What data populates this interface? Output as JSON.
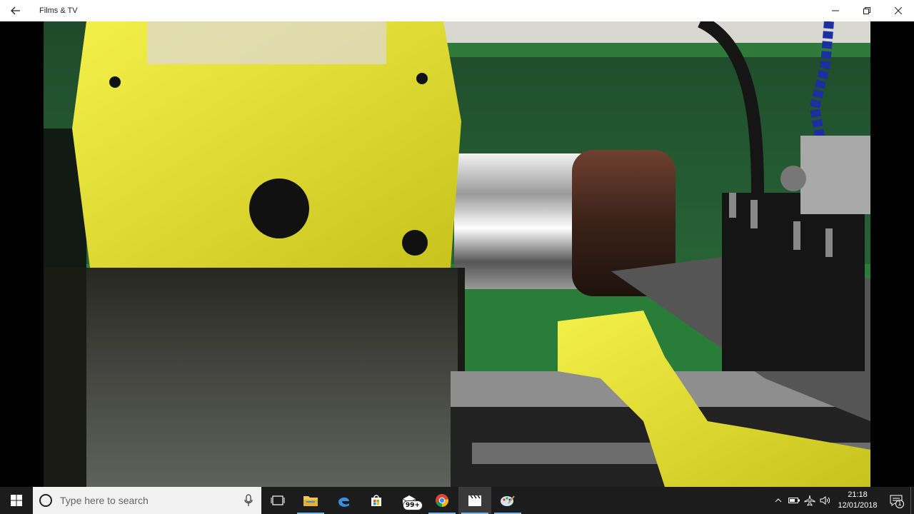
{
  "window": {
    "title": "Films & TV",
    "icons": {
      "back": "back-arrow-icon",
      "minimize": "minimize-icon",
      "restore": "restore-icon",
      "close": "close-icon"
    }
  },
  "video": {
    "description_icon": "video-frame"
  },
  "taskbar": {
    "search_placeholder": "Type here to search",
    "apps": [
      {
        "name": "task-view",
        "icon": "task-view-icon"
      },
      {
        "name": "file-explorer",
        "icon": "folder-icon"
      },
      {
        "name": "edge",
        "icon": "edge-icon"
      },
      {
        "name": "store",
        "icon": "store-icon"
      },
      {
        "name": "mail",
        "icon": "mail-icon",
        "badge": "99+"
      },
      {
        "name": "chrome",
        "icon": "chrome-icon"
      },
      {
        "name": "films-tv",
        "icon": "films-tv-icon"
      },
      {
        "name": "paint",
        "icon": "paint-icon"
      }
    ],
    "clock": {
      "time": "21:18",
      "date": "12/01/2018"
    },
    "notification_count": "1"
  }
}
